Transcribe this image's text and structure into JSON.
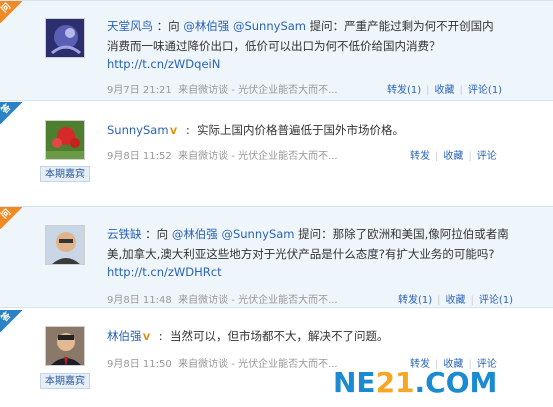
{
  "posts": [
    {
      "type": "question",
      "corner_label": "问",
      "user": "天堂风鸟",
      "sep": "：向",
      "mentions": [
        "@林伯强",
        "@SunnySam"
      ],
      "ask_word": "提问：",
      "text_line1_tail": "严重产能过剩为何不开创国内",
      "text_line2": "消费而一味通过降价出口，低价可以出口为何不低价给国内消费？",
      "link": "http://t.cn/zWDqeiN",
      "date": "9月7日",
      "time": "21:21",
      "source": "来自微访谈 - 光伏企业能否大而不...",
      "actions": [
        "转发(1)",
        "收藏",
        "评论(1)"
      ]
    },
    {
      "type": "answer",
      "corner_label": "答",
      "user": "SunnySam",
      "text": "实际上国内价格普遍低于国外市场价格。",
      "date": "9月8日",
      "time": "11:52",
      "source": "来自微访谈 - 光伏企业能否大而不...",
      "actions": [
        "转发",
        "收藏",
        "评论"
      ],
      "badge": "本期嘉宾"
    },
    {
      "type": "question",
      "corner_label": "问",
      "user": "云铁缺",
      "sep": "：向",
      "mentions": [
        "@林伯强",
        "@SunnySam"
      ],
      "ask_word": "提问：",
      "text_line1_tail": "那除了欧洲和美国,像阿拉伯或者南",
      "text_line2": "美,加拿大,澳大利亚这些地方对于光伏产品是什么态度?有扩大业务的可能吗?",
      "link": "http://t.cn/zWDHRct",
      "date": "9月8日",
      "time": "11:48",
      "source": "来自微访谈 - 光伏企业能否大而不...",
      "actions": [
        "转发(1)",
        "收藏",
        "评论(1)"
      ]
    },
    {
      "type": "answer",
      "corner_label": "答",
      "user": "林伯强",
      "text": "当然可以，但市场都不大，解决不了问题。",
      "date": "9月8日",
      "time": "11:50",
      "source": "来自微访谈 - 光伏企业能否大而不...",
      "actions": [
        "转发",
        "收藏",
        "评论"
      ],
      "badge": "本期嘉宾"
    }
  ],
  "watermark": {
    "part1": "NE",
    "part2": "21",
    "part3": ".COM"
  }
}
